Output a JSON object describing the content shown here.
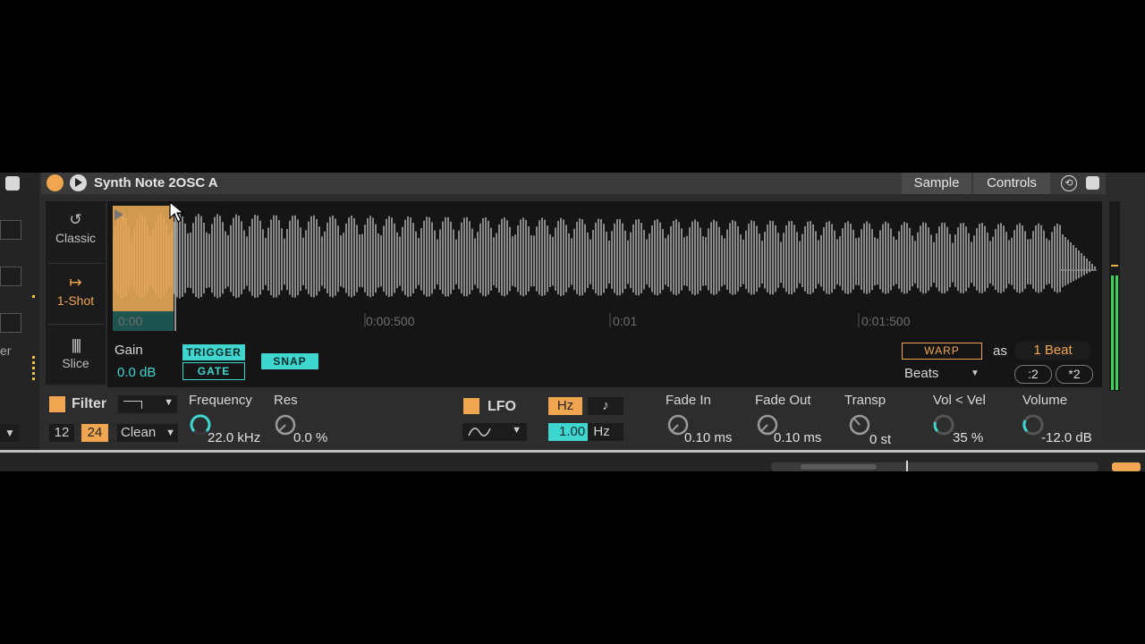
{
  "device": {
    "title": "Synth Note 2OSC A",
    "tabs": [
      "Sample",
      "Controls"
    ]
  },
  "modes": [
    {
      "icon": "loop-icon",
      "label": "Classic"
    },
    {
      "icon": "arrow-right-bar-icon",
      "label": "1-Shot"
    },
    {
      "icon": "slice-icon",
      "label": "Slice"
    }
  ],
  "ruler": {
    "ticks": [
      "0:00",
      "0:00:500",
      "0:01",
      "0:01:500"
    ]
  },
  "sample": {
    "gain_label": "Gain",
    "gain_value": "0.0 dB",
    "trigger_label": "TRIGGER",
    "gate_label": "GATE",
    "snap_label": "SNAP",
    "warp_label": "WARP",
    "as_label": "as",
    "beat_value": "1 Beat",
    "beats_mode": "Beats",
    "half_label": ":2",
    "double_label": "*2"
  },
  "filter": {
    "label": "Filter",
    "slope_12": "12",
    "slope_24": "24",
    "circuit": "Clean",
    "frequency_label": "Frequency",
    "frequency_value": "22.0 kHz",
    "res_label": "Res",
    "res_value": "0.0 %"
  },
  "lfo": {
    "label": "LFO",
    "hz_label": "Hz",
    "note_label": "♪",
    "rate_value": "1.00",
    "rate_unit": "Hz"
  },
  "envelope": {
    "fade_in_label": "Fade In",
    "fade_in_value": "0.10 ms",
    "fade_out_label": "Fade Out",
    "fade_out_value": "0.10 ms",
    "transp_label": "Transp",
    "transp_value": "0 st",
    "vol_vel_label": "Vol < Vel",
    "vol_vel_value": "35 %",
    "volume_label": "Volume",
    "volume_value": "-12.0 dB"
  },
  "colors": {
    "accent_orange": "#f0a650",
    "accent_cyan": "#3fd6d0",
    "waveform": "#8a8a8a",
    "meter_green": "#3fcf5a"
  },
  "left_partial_text": "er"
}
